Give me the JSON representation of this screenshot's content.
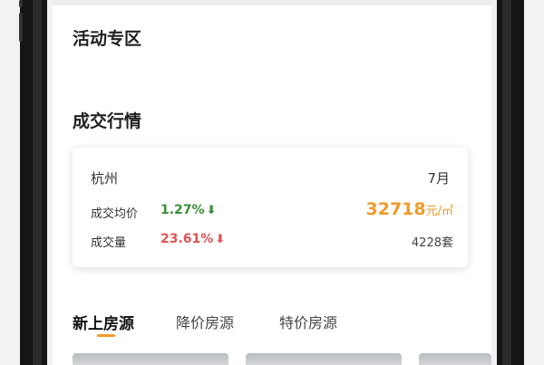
{
  "sections": {
    "activity_title": "活动专区",
    "market_title": "成交行情"
  },
  "market_card": {
    "city": "杭州",
    "month": "7月",
    "avg_price_label": "成交均价",
    "avg_price_change": "1.27%",
    "avg_price_value": "32718",
    "avg_price_unit": "元/㎡",
    "volume_label": "成交量",
    "volume_change": "23.61%",
    "volume_value": "4228套",
    "down_arrow": "⬇",
    "colors": {
      "increase_green": "#3a8f3a",
      "change_red": "#e05353",
      "price_orange": "#f09a27"
    }
  },
  "tabs": [
    {
      "label": "新上房源",
      "active": true
    },
    {
      "label": "降价房源",
      "active": false
    },
    {
      "label": "特价房源",
      "active": false
    }
  ],
  "accent_color": "#f09a27"
}
